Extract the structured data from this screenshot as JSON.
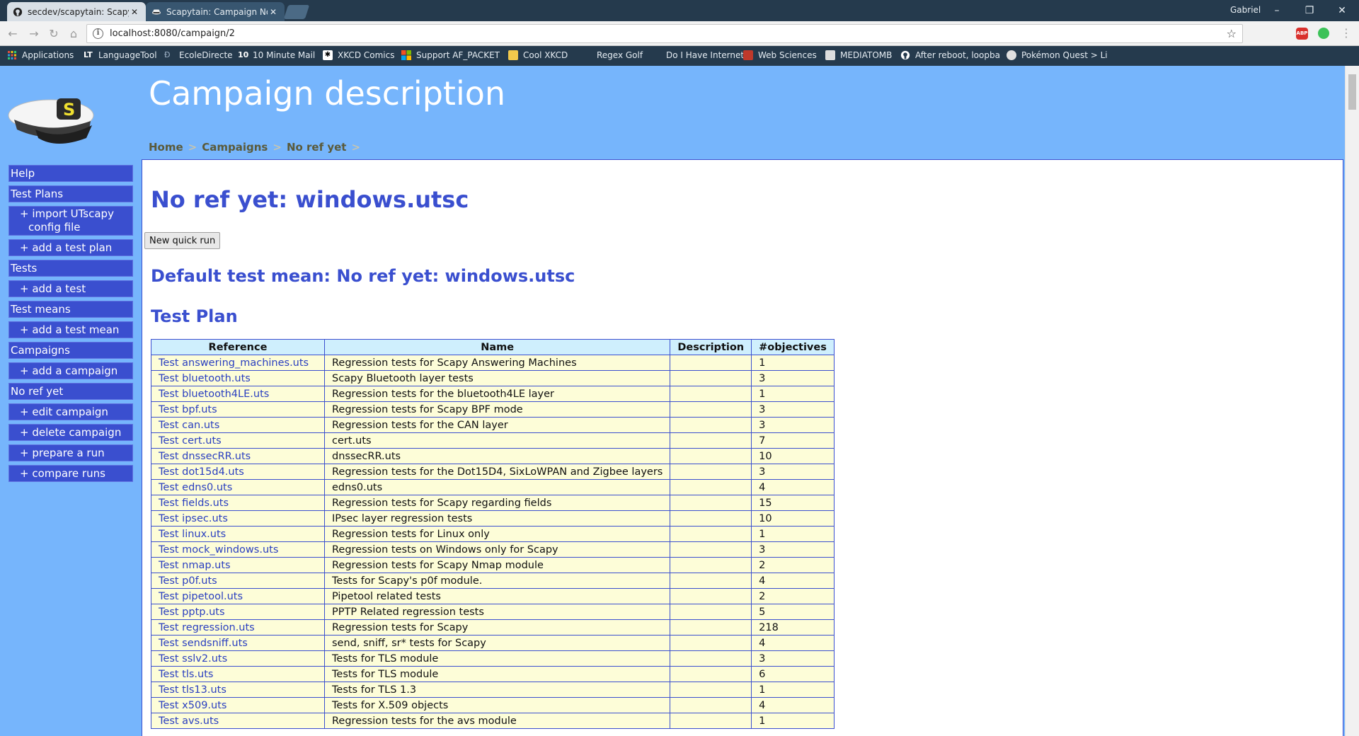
{
  "browser": {
    "tabs": [
      {
        "title": "secdev/scapytain: Scapyt",
        "active": false
      },
      {
        "title": "Scapytain: Campaign No",
        "active": true
      }
    ],
    "profile_name": "Gabriel",
    "url": "localhost:8080/campaign/2",
    "bookmarks": [
      {
        "label": "Applications",
        "icon": "apps-grid-icon"
      },
      {
        "label": "LanguageTool",
        "icon": "languagetool-icon"
      },
      {
        "label": "EcoleDirecte",
        "icon": "ecoledirecte-icon"
      },
      {
        "label": "10 Minute Mail",
        "icon": "ten-minute-mail-icon"
      },
      {
        "label": "XKCD Comics",
        "icon": "xkcd-icon"
      },
      {
        "label": "Support AF_PACKET",
        "icon": "windows-icon"
      },
      {
        "label": "Cool XKCD",
        "icon": "folder-icon"
      },
      {
        "label": "Regex Golf",
        "icon": "blank-page-icon"
      },
      {
        "label": "Do I Have Internet",
        "icon": "blank-page-icon"
      },
      {
        "label": "Web Sciences",
        "icon": "web-sciences-icon"
      },
      {
        "label": "MEDIATOMB",
        "icon": "mediatomb-icon"
      },
      {
        "label": "After reboot, loopba",
        "icon": "github-icon"
      },
      {
        "label": "Pokémon Quest > Li",
        "icon": "pokemon-icon"
      }
    ]
  },
  "header": {
    "title": "Campaign description",
    "breadcrumb": [
      "Home",
      "Campaigns",
      "No ref yet"
    ]
  },
  "sidebar": {
    "items": [
      {
        "label": "Help",
        "level": 0
      },
      {
        "label": "Test Plans",
        "level": 0
      },
      {
        "label": "+ import UTscapy config file",
        "level": 1,
        "lines": [
          "+ import UTscapy",
          "config file"
        ]
      },
      {
        "label": "+ add a test plan",
        "level": 1
      },
      {
        "label": "Tests",
        "level": 0
      },
      {
        "label": "+ add a test",
        "level": 1
      },
      {
        "label": "Test means",
        "level": 0
      },
      {
        "label": "+ add a test mean",
        "level": 1
      },
      {
        "label": "Campaigns",
        "level": 0
      },
      {
        "label": "+ add a campaign",
        "level": 1
      },
      {
        "label": "No ref yet",
        "level": 0
      },
      {
        "label": "+ edit campaign",
        "level": 1
      },
      {
        "label": "+ delete campaign",
        "level": 1
      },
      {
        "label": "+ prepare a run",
        "level": 1
      },
      {
        "label": "+ compare runs",
        "level": 1
      }
    ]
  },
  "main": {
    "campaign_title": "No ref yet: windows.utsc",
    "quick_run_label": "New quick run",
    "default_test_mean": "Default test mean: No ref yet: windows.utsc",
    "test_plan_heading": "Test Plan",
    "table": {
      "columns": [
        "Reference",
        "Name",
        "Description",
        "#objectives"
      ],
      "rows": [
        {
          "reference": "Test answering_machines.uts",
          "name": "Regression tests for Scapy Answering Machines",
          "description": "",
          "objectives": "1"
        },
        {
          "reference": "Test bluetooth.uts",
          "name": "Scapy Bluetooth layer tests",
          "description": "",
          "objectives": "3"
        },
        {
          "reference": "Test bluetooth4LE.uts",
          "name": "Regression tests for the bluetooth4LE layer",
          "description": "",
          "objectives": "1"
        },
        {
          "reference": "Test bpf.uts",
          "name": "Regression tests for Scapy BPF mode",
          "description": "",
          "objectives": "3"
        },
        {
          "reference": "Test can.uts",
          "name": "Regression tests for the CAN layer",
          "description": "",
          "objectives": "3"
        },
        {
          "reference": "Test cert.uts",
          "name": "cert.uts",
          "description": "",
          "objectives": "7"
        },
        {
          "reference": "Test dnssecRR.uts",
          "name": "dnssecRR.uts",
          "description": "",
          "objectives": "10"
        },
        {
          "reference": "Test dot15d4.uts",
          "name": "Regression tests for the Dot15D4, SixLoWPAN and Zigbee layers",
          "description": "",
          "objectives": "3"
        },
        {
          "reference": "Test edns0.uts",
          "name": "edns0.uts",
          "description": "",
          "objectives": "4"
        },
        {
          "reference": "Test fields.uts",
          "name": "Regression tests for Scapy regarding fields",
          "description": "",
          "objectives": "15"
        },
        {
          "reference": "Test ipsec.uts",
          "name": "IPsec layer regression tests",
          "description": "",
          "objectives": "10"
        },
        {
          "reference": "Test linux.uts",
          "name": "Regression tests for Linux only",
          "description": "",
          "objectives": "1"
        },
        {
          "reference": "Test mock_windows.uts",
          "name": "Regression tests on Windows only for Scapy",
          "description": "",
          "objectives": "3"
        },
        {
          "reference": "Test nmap.uts",
          "name": "Regression tests for Scapy Nmap module",
          "description": "",
          "objectives": "2"
        },
        {
          "reference": "Test p0f.uts",
          "name": "Tests for Scapy's p0f module.",
          "description": "",
          "objectives": "4"
        },
        {
          "reference": "Test pipetool.uts",
          "name": "Pipetool related tests",
          "description": "",
          "objectives": "2"
        },
        {
          "reference": "Test pptp.uts",
          "name": "PPTP Related regression tests",
          "description": "",
          "objectives": "5"
        },
        {
          "reference": "Test regression.uts",
          "name": "Regression tests for Scapy",
          "description": "",
          "objectives": "218"
        },
        {
          "reference": "Test sendsniff.uts",
          "name": "send, sniff, sr* tests for Scapy",
          "description": "",
          "objectives": "4"
        },
        {
          "reference": "Test sslv2.uts",
          "name": "Tests for TLS module",
          "description": "",
          "objectives": "3"
        },
        {
          "reference": "Test tls.uts",
          "name": "Tests for TLS module",
          "description": "",
          "objectives": "6"
        },
        {
          "reference": "Test tls13.uts",
          "name": "Tests for TLS 1.3",
          "description": "",
          "objectives": "1"
        },
        {
          "reference": "Test x509.uts",
          "name": "Tests for X.509 objects",
          "description": "",
          "objectives": "4"
        },
        {
          "reference": "Test avs.uts",
          "name": "Regression tests for the avs module",
          "description": "",
          "objectives": "1"
        }
      ]
    }
  },
  "colors": {
    "page_background": "#76b5fc",
    "nav_background": "#3a4fcf",
    "heading": "#3a4fcf",
    "table_header": "#cfeffd",
    "table_row": "#fdfdd8"
  }
}
